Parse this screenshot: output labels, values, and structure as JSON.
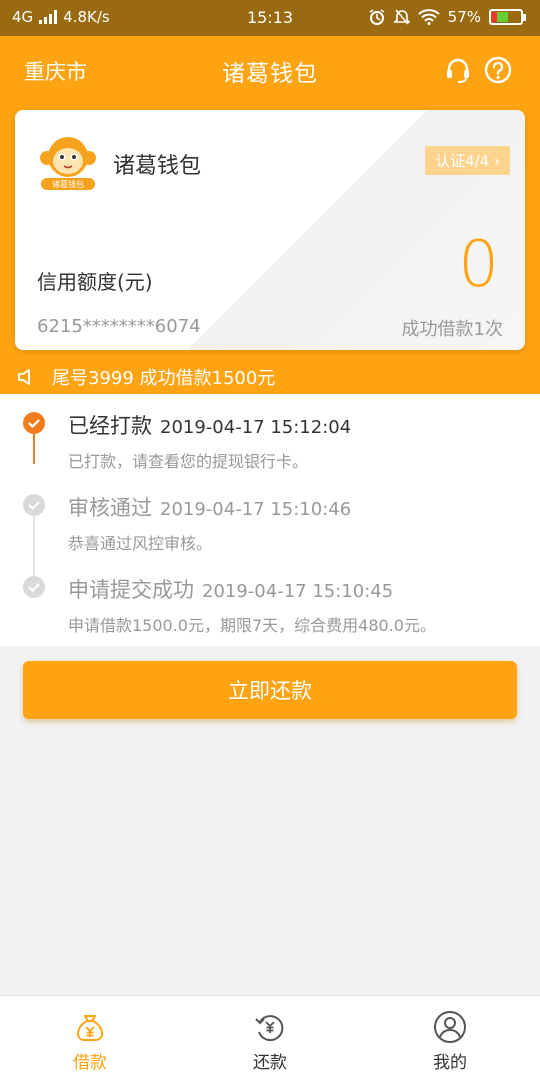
{
  "status_bar": {
    "network": "4G",
    "speed": "4.8K/s",
    "time": "15:13",
    "battery": "57%",
    "battery_level": 0.57
  },
  "header": {
    "city": "重庆市",
    "title": "诸葛钱包",
    "icons": [
      "headset-icon",
      "help-icon"
    ]
  },
  "card": {
    "logo_text": "诸葛钱包",
    "brand_name": "诸葛钱包",
    "certification": "认证4/4",
    "credit_label": "信用额度(元)",
    "credit_value": "0",
    "card_number": "6215********6074",
    "loan_count": "成功借款1次"
  },
  "notice": {
    "text": "尾号3999 成功借款1500元"
  },
  "timeline": [
    {
      "title": "已经打款",
      "datetime": "2019-04-17 15:12:04",
      "desc": "已打款，请查看您的提现银行卡。",
      "status": "done"
    },
    {
      "title": "审核通过",
      "datetime": "2019-04-17 15:10:46",
      "desc": "恭喜通过风控审核。",
      "status": "past"
    },
    {
      "title": "申请提交成功",
      "datetime": "2019-04-17 15:10:45",
      "desc": "申请借款1500.0元，期限7天，综合费用480.0元。",
      "status": "past"
    }
  ],
  "action": {
    "repay_label": "立即还款"
  },
  "tabs": [
    {
      "label": "借款",
      "icon": "money-bag-icon",
      "active": true
    },
    {
      "label": "还款",
      "icon": "repay-icon",
      "active": false
    },
    {
      "label": "我的",
      "icon": "user-icon",
      "active": false
    }
  ],
  "colors": {
    "accent": "#fea311",
    "status_bar": "#9a6a10",
    "timeline_active": "#f07c1e",
    "inactive": "#cccccc"
  }
}
